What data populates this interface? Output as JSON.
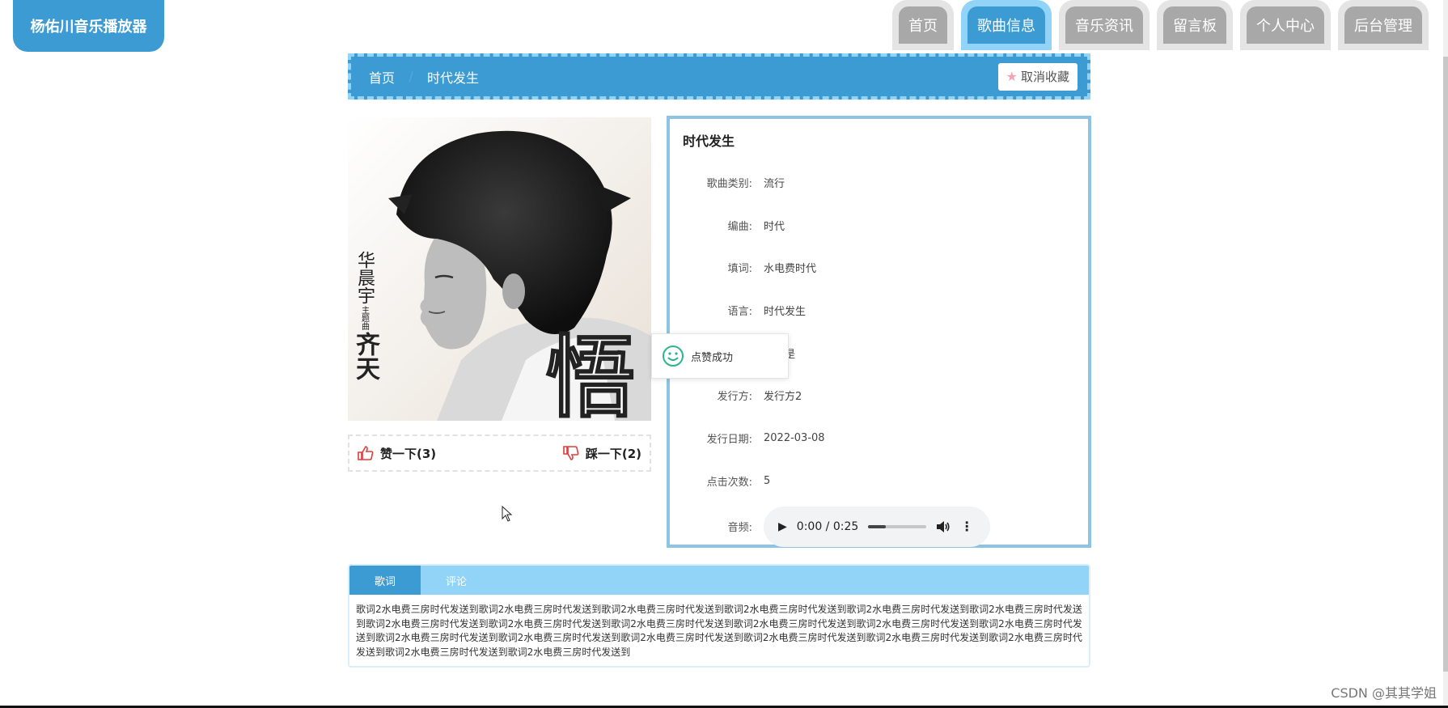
{
  "app": {
    "logo_text": "杨佑川音乐播放器"
  },
  "nav": {
    "tabs": [
      {
        "label": "首页",
        "active": false
      },
      {
        "label": "歌曲信息",
        "active": true
      },
      {
        "label": "音乐资讯",
        "active": false
      },
      {
        "label": "留言板",
        "active": false
      },
      {
        "label": "个人中心",
        "active": false
      },
      {
        "label": "后台管理",
        "active": false
      }
    ]
  },
  "breadcrumb": {
    "home": "首页",
    "current": "时代发生",
    "favorite_button": "取消收藏"
  },
  "cover": {
    "side_name": "华晨宇",
    "side_note": "主题曲",
    "side_title": "齐天",
    "big_char": "悟"
  },
  "votes": {
    "like_label": "赞一下(3)",
    "dislike_label": "踩一下(2)"
  },
  "song": {
    "title": "时代发生",
    "fields": [
      {
        "label": "歌曲类别:",
        "value": "流行"
      },
      {
        "label": "编曲:",
        "value": "时代"
      },
      {
        "label": "填词:",
        "value": "水电费时代"
      },
      {
        "label": "语言:",
        "value": "时代发生"
      },
      {
        "label": "",
        "value": "电费是"
      },
      {
        "label": "发行方:",
        "value": "发行方2"
      },
      {
        "label": "发行日期:",
        "value": "2022-03-08"
      },
      {
        "label": "点击次数:",
        "value": "5"
      }
    ],
    "audio_label": "音频:",
    "audio_time": "0:00 / 0:25",
    "audio_progress": 0.3
  },
  "toast": {
    "message": "点赞成功"
  },
  "lyrics": {
    "tabs": [
      {
        "label": "歌词",
        "active": true
      },
      {
        "label": "评论",
        "active": false
      }
    ],
    "text": "歌词2水电费三房时代发送到歌词2水电费三房时代发送到歌词2水电费三房时代发送到歌词2水电费三房时代发送到歌词2水电费三房时代发送到歌词2水电费三房时代发送到歌词2水电费三房时代发送到歌词2水电费三房时代发送到歌词2水电费三房时代发送到歌词2水电费三房时代发送到歌词2水电费三房时代发送到歌词2水电费三房时代发送到歌词2水电费三房时代发送到歌词2水电费三房时代发送到歌词2水电费三房时代发送到歌词2水电费三房时代发送到歌词2水电费三房时代发送到歌词2水电费三房时代发送到歌词2水电费三房时代发送到歌词2水电费三房时代发送到"
  },
  "watermark": "CSDN @其其学姐",
  "colors": {
    "primary": "#3d9bd3",
    "accent_light": "#91d4f7",
    "tab_inactive": "#a8a8a8"
  }
}
